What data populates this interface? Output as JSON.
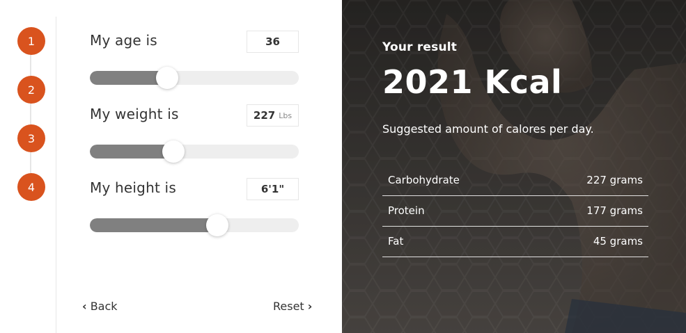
{
  "steps": [
    "1",
    "2",
    "3",
    "4"
  ],
  "fields": [
    {
      "label": "My age is",
      "value": "36",
      "unit": "",
      "fill": 0.37
    },
    {
      "label": "My weight is",
      "value": "227",
      "unit": "Lbs",
      "fill": 0.4
    },
    {
      "label": "My height is",
      "value": "6'1\"",
      "unit": "",
      "fill": 0.61
    }
  ],
  "nav": {
    "back_label": "Back",
    "reset_label": "Reset"
  },
  "result": {
    "heading": "Your result",
    "kcal": "2021 Kcal",
    "suggestion": "Suggested amount of calores per day.",
    "macros": [
      {
        "name": "Carbohydrate",
        "amount": "227 grams"
      },
      {
        "name": "Protein",
        "amount": "177 grams"
      },
      {
        "name": "Fat",
        "amount": "45 grams"
      }
    ]
  },
  "colors": {
    "accent": "#d9531e",
    "slider_fill": "#808080",
    "slider_track": "#eeeeee",
    "panel_dark": "#3b3836"
  }
}
